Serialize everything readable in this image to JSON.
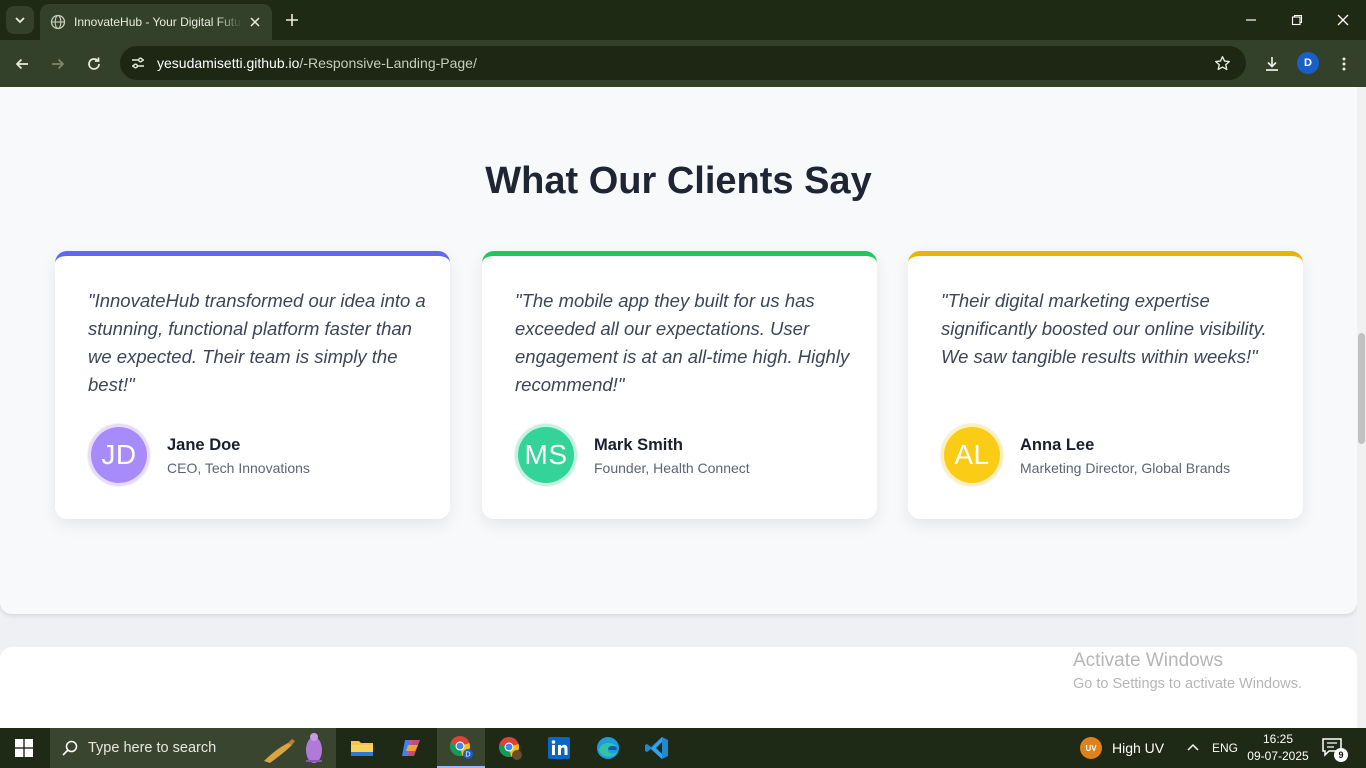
{
  "browser": {
    "tab_title": "InnovateHub - Your Digital Future",
    "url_host": "yesudamisetti.github.io",
    "url_path": "/-Responsive-Landing-Page/",
    "profile_initial": "D"
  },
  "section": {
    "heading": "What Our Clients Say",
    "testimonials": [
      {
        "quote": "\"InnovateHub transformed our idea into a stunning, functional platform faster than we expected. Their team is simply the best!\"",
        "initials": "JD",
        "name": "Jane Doe",
        "role": "CEO, Tech Innovations",
        "accent_color": "#6366f1",
        "avatar_color": "#a78bfa"
      },
      {
        "quote": "\"The mobile app they built for us has exceeded all our expectations. User engagement is at an all-time high. Highly recommend!\"",
        "initials": "MS",
        "name": "Mark Smith",
        "role": "Founder, Health Connect",
        "accent_color": "#22c55e",
        "avatar_color": "#34d399"
      },
      {
        "quote": "\"Their digital marketing expertise significantly boosted our online visibility. We saw tangible results within weeks!\"",
        "initials": "AL",
        "name": "Anna Lee",
        "role": "Marketing Director, Global Brands",
        "accent_color": "#eab308",
        "avatar_color": "#facc15"
      }
    ]
  },
  "watermark": {
    "line1": "Activate Windows",
    "line2": "Go to Settings to activate Windows."
  },
  "taskbar": {
    "search_placeholder": "Type here to search",
    "weather_badge": "UV",
    "weather_text": "High UV",
    "language": "ENG",
    "time": "16:25",
    "date": "09-07-2025",
    "notification_count": "9",
    "apps": [
      "file-explorer-icon",
      "copilot-icon",
      "chrome-profile-icon",
      "chrome-icon",
      "linkedin-icon",
      "edge-icon",
      "vscode-icon"
    ]
  }
}
